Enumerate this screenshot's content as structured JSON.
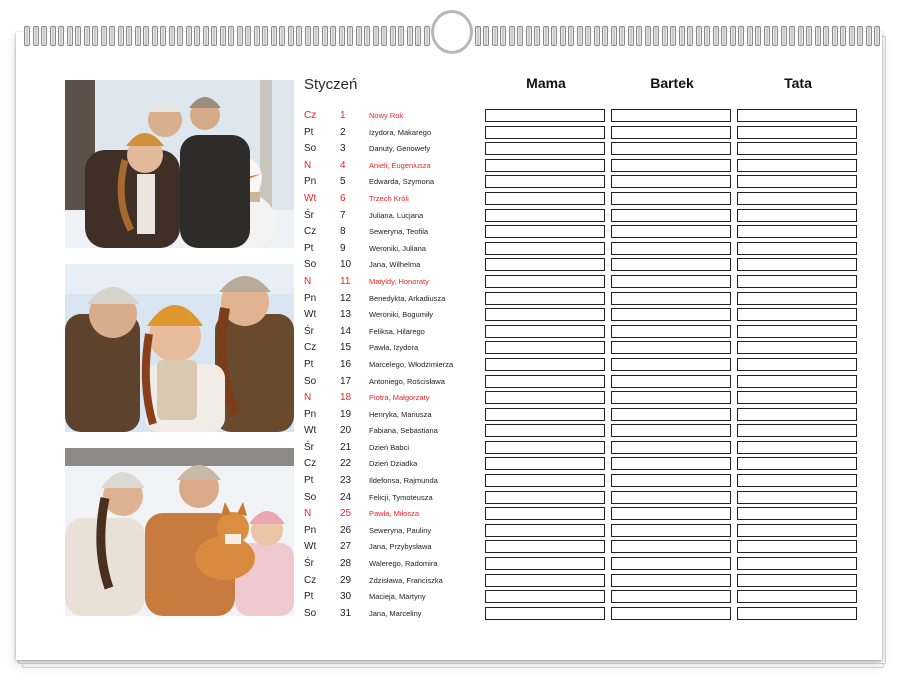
{
  "calendar": {
    "month": "Styczeń",
    "members": [
      "Mama",
      "Bartek",
      "Tata"
    ],
    "colors": {
      "holiday": "#e8252a",
      "text": "#222222"
    },
    "days": [
      {
        "dow": "Cz",
        "day": "1",
        "names": "Nowy Rok",
        "holiday": true
      },
      {
        "dow": "Pt",
        "day": "2",
        "names": "Izydora, Makarego",
        "holiday": false
      },
      {
        "dow": "So",
        "day": "3",
        "names": "Danuty, Genowefy",
        "holiday": false
      },
      {
        "dow": "N",
        "day": "4",
        "names": "Anieli, Eugeniusza",
        "holiday": true
      },
      {
        "dow": "Pn",
        "day": "5",
        "names": "Edwarda, Szymona",
        "holiday": false
      },
      {
        "dow": "Wt",
        "day": "6",
        "names": "Trzech Króli",
        "holiday": true
      },
      {
        "dow": "Śr",
        "day": "7",
        "names": "Juliana, Lucjana",
        "holiday": false
      },
      {
        "dow": "Cz",
        "day": "8",
        "names": "Seweryna, Teofila",
        "holiday": false
      },
      {
        "dow": "Pt",
        "day": "9",
        "names": "Weroniki, Juliana",
        "holiday": false
      },
      {
        "dow": "So",
        "day": "10",
        "names": "Jana, Wilhelma",
        "holiday": false
      },
      {
        "dow": "N",
        "day": "11",
        "names": "Matyldy, Honoraty",
        "holiday": true
      },
      {
        "dow": "Pn",
        "day": "12",
        "names": "Benedykta, Arkadiusza",
        "holiday": false
      },
      {
        "dow": "Wt",
        "day": "13",
        "names": "Weroniki, Bogumiły",
        "holiday": false
      },
      {
        "dow": "Śr",
        "day": "14",
        "names": "Feliksa, Hilarego",
        "holiday": false
      },
      {
        "dow": "Cz",
        "day": "15",
        "names": "Pawła, Izydora",
        "holiday": false
      },
      {
        "dow": "Pt",
        "day": "16",
        "names": "Marcelego, Włodzimierza",
        "holiday": false
      },
      {
        "dow": "So",
        "day": "17",
        "names": "Antoniego, Rościsława",
        "holiday": false
      },
      {
        "dow": "N",
        "day": "18",
        "names": "Piotra, Małgorzaty",
        "holiday": true
      },
      {
        "dow": "Pn",
        "day": "19",
        "names": "Henryka, Mariusza",
        "holiday": false
      },
      {
        "dow": "Wt",
        "day": "20",
        "names": "Fabiana, Sebastiana",
        "holiday": false
      },
      {
        "dow": "Śr",
        "day": "21",
        "names": "Dzień Babci",
        "holiday": false
      },
      {
        "dow": "Cz",
        "day": "22",
        "names": "Dzień Dziadka",
        "holiday": false
      },
      {
        "dow": "Pt",
        "day": "23",
        "names": "Ildefonsa, Rajmunda",
        "holiday": false
      },
      {
        "dow": "So",
        "day": "24",
        "names": "Felicji, Tymoteusza",
        "holiday": false
      },
      {
        "dow": "N",
        "day": "25",
        "names": "Pawła, Miłosza",
        "holiday": true
      },
      {
        "dow": "Pn",
        "day": "26",
        "names": "Seweryna, Pauliny",
        "holiday": false
      },
      {
        "dow": "Wt",
        "day": "27",
        "names": "Jana, Przybysława",
        "holiday": false
      },
      {
        "dow": "Śr",
        "day": "28",
        "names": "Walerego, Radomira",
        "holiday": false
      },
      {
        "dow": "Cz",
        "day": "29",
        "names": "Zdzisława, Franciszka",
        "holiday": false
      },
      {
        "dow": "Pt",
        "day": "30",
        "names": "Macieja, Martyny",
        "holiday": false
      },
      {
        "dow": "So",
        "day": "31",
        "names": "Jana, Marceliny",
        "holiday": false
      }
    ]
  }
}
